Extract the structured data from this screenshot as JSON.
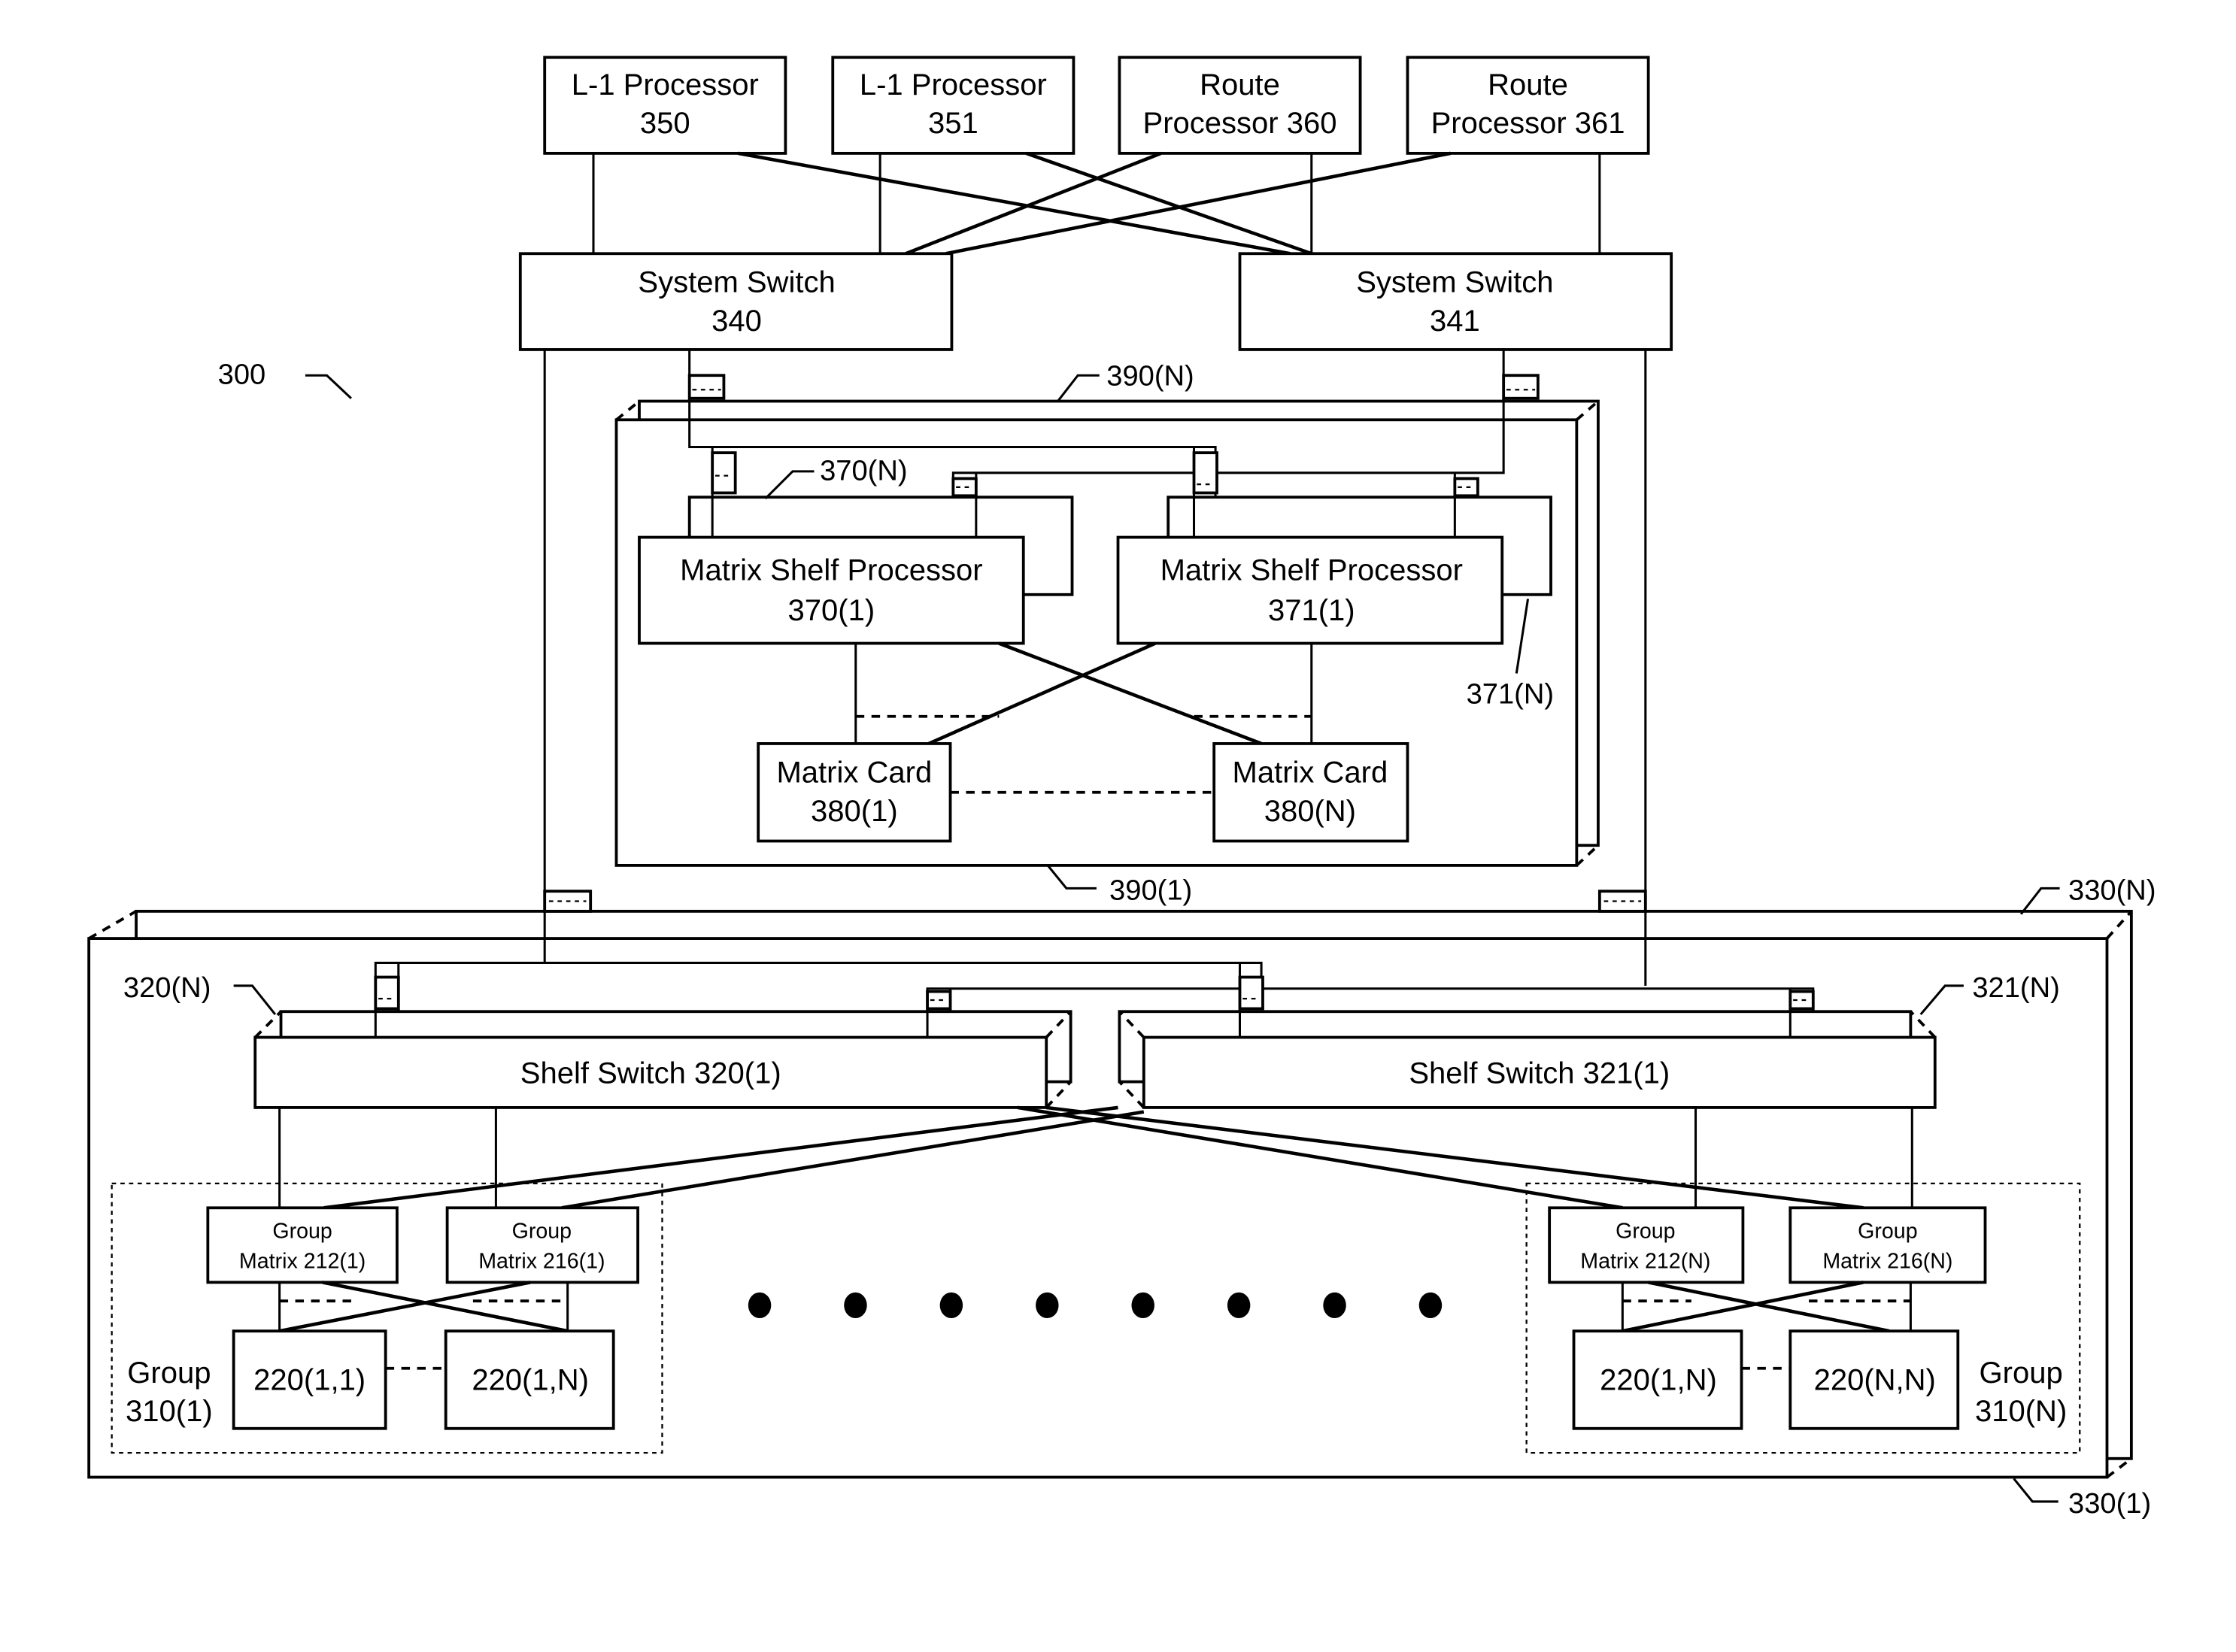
{
  "figure": {
    "reference": "300",
    "processors": [
      {
        "line1": "L-1 Processor",
        "line2": "350"
      },
      {
        "line1": "L-1 Processor",
        "line2": "351"
      },
      {
        "line1": "Route",
        "line2": "Processor 360"
      },
      {
        "line1": "Route",
        "line2": "Processor 361"
      }
    ],
    "system_switches": [
      {
        "line1": "System Switch",
        "line2": "340"
      },
      {
        "line1": "System Switch",
        "line2": "341"
      }
    ],
    "matrix_shelf": {
      "label_front": "390(1)",
      "label_back": "390(N)",
      "processors": [
        {
          "line1": "Matrix Shelf Processor",
          "line2": "370(1)",
          "back_label": "370(N)"
        },
        {
          "line1": "Matrix Shelf Processor",
          "line2": "371(1)",
          "back_label": "371(N)"
        }
      ],
      "cards": [
        {
          "line1": "Matrix Card",
          "line2": "380(1)"
        },
        {
          "line1": "Matrix Card",
          "line2": "380(N)"
        }
      ]
    },
    "port_shelf": {
      "label_front": "330(1)",
      "label_back": "330(N)",
      "shelf_switches": [
        {
          "label": "Shelf Switch 320(1)",
          "back_label": "320(N)"
        },
        {
          "label": "Shelf Switch 321(1)",
          "back_label": "321(N)"
        }
      ],
      "groups": [
        {
          "line1": "Group",
          "line2": "310(1)",
          "matrices": [
            {
              "line1": "Group",
              "line2": "Matrix 212(1)"
            },
            {
              "line1": "Group",
              "line2": "Matrix 216(1)"
            }
          ],
          "line_cards": [
            "220(1,1)",
            "220(1,N)"
          ]
        },
        {
          "line1": "Group",
          "line2": "310(N)",
          "matrices": [
            {
              "line1": "Group",
              "line2": "Matrix 212(N)"
            },
            {
              "line1": "Group",
              "line2": "Matrix 216(N)"
            }
          ],
          "line_cards": [
            "220(1,N)",
            "220(N,N)"
          ]
        }
      ],
      "ellipsis_dots": 8
    }
  }
}
